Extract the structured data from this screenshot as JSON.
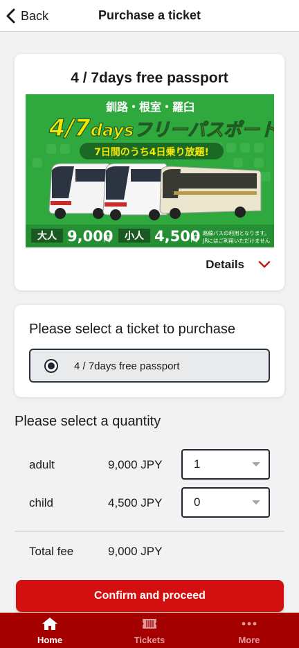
{
  "header": {
    "back_label": "Back",
    "title": "Purchase a ticket"
  },
  "product": {
    "title": "4 / 7days free passport",
    "details_label": "Details",
    "banner": {
      "region": "釧路・根室・羅臼",
      "name_prefix": "4/7",
      "name_days": "days",
      "name_suffix": "フリーパスポート",
      "tagline": "7日間のうち4日乗り放題!",
      "adult_label": "大人",
      "adult_price": "9,000",
      "child_label": "小人",
      "child_price": "4,500",
      "yen": "円",
      "note_line1": "路線バスの利用となります。",
      "note_line2": "JRにはご利用いただけません"
    }
  },
  "ticket_select": {
    "heading": "Please select a ticket to purchase",
    "option_label": "4 / 7days free passport",
    "selected": true
  },
  "quantity": {
    "heading": "Please select a quantity",
    "rows": [
      {
        "name": "adult",
        "price": "9,000 JPY",
        "value": "1"
      },
      {
        "name": "child",
        "price": "4,500 JPY",
        "value": "0"
      }
    ],
    "total_label": "Total fee",
    "total_value": "9,000 JPY"
  },
  "confirm_label": "Confirm and proceed",
  "tabbar": {
    "tabs": [
      {
        "label": "Home",
        "icon": "home-icon",
        "active": true
      },
      {
        "label": "Tickets",
        "icon": "ticket-icon",
        "active": false
      },
      {
        "label": "More",
        "icon": "more-icon",
        "active": false
      }
    ]
  },
  "colors": {
    "accent_red": "#d40f0f",
    "tabbar_bg": "#a50000",
    "banner_green": "#2fa83e",
    "banner_yellow": "#f7e600"
  }
}
